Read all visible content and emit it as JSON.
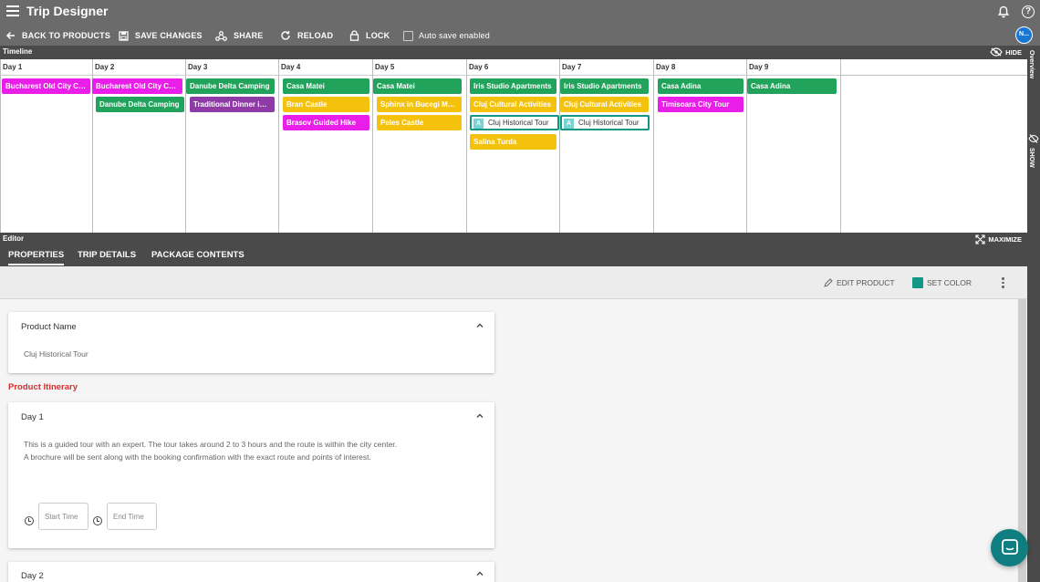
{
  "app": {
    "title": "Trip Designer"
  },
  "toolbar": {
    "back": "BACK TO PRODUCTS",
    "save": "SAVE CHANGES",
    "share": "SHARE",
    "reload": "RELOAD",
    "lock": "LOCK",
    "autosave": "Auto save enabled",
    "avatar": "N..."
  },
  "timeline": {
    "label": "Timeline",
    "hide": "HIDE",
    "overview": "Overview",
    "show": "SHOW",
    "days": [
      "Day 1",
      "Day 2",
      "Day 3",
      "Day 4",
      "Day 5",
      "Day 6",
      "Day 7",
      "Day 8",
      "Day 9"
    ],
    "chips": [
      "Bucharest Old City Ce...",
      "Bucharest Old City Ce...",
      "Danube Delta Camping",
      "Danube Delta Camping",
      "Traditional Dinner in t...",
      "Casa Matei",
      "Bran Castle",
      "Brasov Guided Hike",
      "Casa Matei",
      "Sphinx in Bucegi Mou...",
      "Peles Castle",
      "Iris Studio Apartments",
      "Cluj Cultural Activities",
      "Cluj Historical Tour",
      "Salina Turda",
      "Iris Studio Apartments",
      "Cluj Cultural Activities",
      "Cluj Historical Tour",
      "Casa Adina",
      "Timisoara City Tour",
      "Casa Adina"
    ],
    "tag_letter": "A",
    "colors": {
      "magenta": "#e91ee9",
      "green": "#21a35b",
      "yellow": "#f4c20d",
      "purple": "#8e3aa7",
      "teal": "#139683"
    }
  },
  "editor": {
    "label": "Editor",
    "maximize": "MAXIMIZE",
    "tabs": [
      "PROPERTIES",
      "TRIP DETAILS",
      "PACKAGE CONTENTS"
    ],
    "edit_product": "EDIT PRODUCT",
    "set_color": "SET COLOR",
    "product_name_title": "Product Name",
    "product_name_value": "Cluj Historical Tour",
    "itinerary_title": "Product Itinerary",
    "day1_title": "Day 1",
    "day1_line1": "This is a guided tour with an expert. The tour takes around 2 to 3 hours and the route is within the city center.",
    "day1_line2": "A brochure will be sent along with the booking confirmation with the exact route and points of interest.",
    "start_time": "Start Time",
    "end_time": "End Time",
    "day2_title": "Day 2"
  }
}
